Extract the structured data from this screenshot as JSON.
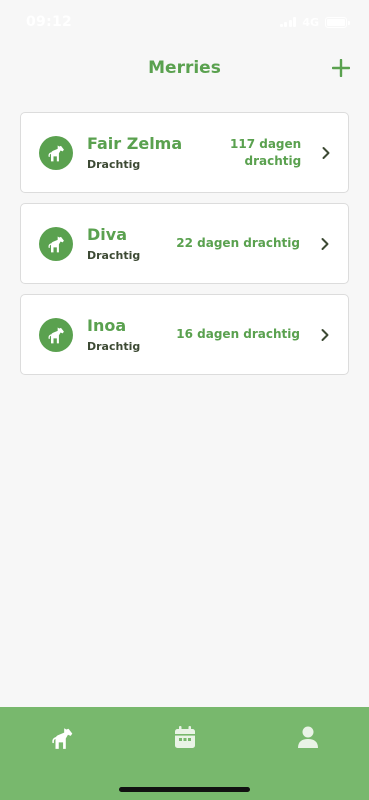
{
  "status_bar": {
    "time": "09:12",
    "network": "4G"
  },
  "header": {
    "title": "Merries",
    "add_icon": "plus-icon"
  },
  "mares": [
    {
      "name": "Fair Zelma",
      "status": "Drachtig",
      "days": "117 dagen drachtig",
      "icon": "horse-icon"
    },
    {
      "name": "Diva",
      "status": "Drachtig",
      "days": "22 dagen drachtig",
      "icon": "horse-icon"
    },
    {
      "name": "Inoa",
      "status": "Drachtig",
      "days": "16 dagen drachtig",
      "icon": "horse-icon"
    }
  ],
  "tabbar": {
    "tabs": [
      {
        "icon": "horse-icon",
        "active": true
      },
      {
        "icon": "calendar-icon",
        "active": false
      },
      {
        "icon": "user-icon",
        "active": false
      }
    ]
  },
  "colors": {
    "accent": "#5aa14f",
    "tabbar": "#78b86d",
    "background": "#f7f7f7",
    "card": "#ffffff"
  }
}
